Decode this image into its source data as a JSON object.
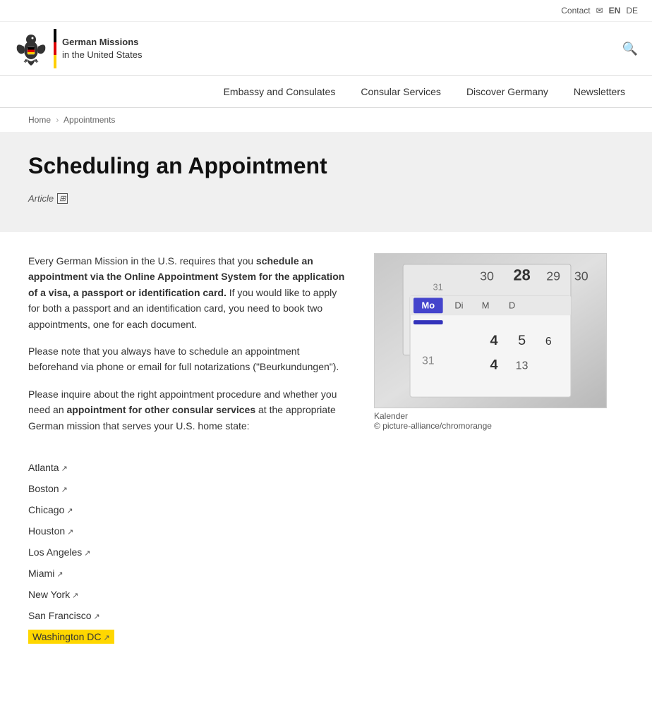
{
  "header": {
    "top": {
      "contact_label": "Contact",
      "lang_en": "EN",
      "lang_de": "DE"
    },
    "logo": {
      "line1": "German Missions",
      "line2": "in the United States"
    },
    "search_aria": "Search"
  },
  "nav": {
    "items": [
      {
        "label": "Embassy and Consulates",
        "id": "nav-embassy"
      },
      {
        "label": "Consular Services",
        "id": "nav-consular"
      },
      {
        "label": "Discover Germany",
        "id": "nav-discover"
      },
      {
        "label": "Newsletters",
        "id": "nav-newsletters"
      }
    ]
  },
  "breadcrumb": {
    "home": "Home",
    "current": "Appointments"
  },
  "hero": {
    "title": "Scheduling an Appointment",
    "article_label": "Article"
  },
  "content": {
    "paragraph1_pre": "Every German Mission in the U.S. requires that you ",
    "paragraph1_bold": "schedule an appointment via the Online Appointment System for the application of a visa, a passport or identification card.",
    "paragraph1_post": " If you would like to apply for both a passport and an identification card, you need to book two appointments, one for each document.",
    "paragraph2": "Please note that you always have to schedule an appointment beforehand via phone or email for full notarizations (\"Beurkundungen\").",
    "paragraph3_pre": "Please inquire about the right appointment procedure and whether you need an ",
    "paragraph3_bold": "appointment for other consular services",
    "paragraph3_post": " at the appropriate German mission that  serves your U.S. home state:",
    "image_caption_line1": "Kalender",
    "image_caption_line2": "© picture-alliance/chromorange"
  },
  "cities": [
    {
      "name": "Atlanta",
      "highlighted": false
    },
    {
      "name": "Boston",
      "highlighted": false
    },
    {
      "name": "Chicago",
      "highlighted": false
    },
    {
      "name": "Houston",
      "highlighted": false
    },
    {
      "name": "Los Angeles",
      "highlighted": false
    },
    {
      "name": "Miami",
      "highlighted": false
    },
    {
      "name": "New York",
      "highlighted": false
    },
    {
      "name": "San Francisco",
      "highlighted": false
    },
    {
      "name": "Washington DC",
      "highlighted": true
    }
  ]
}
